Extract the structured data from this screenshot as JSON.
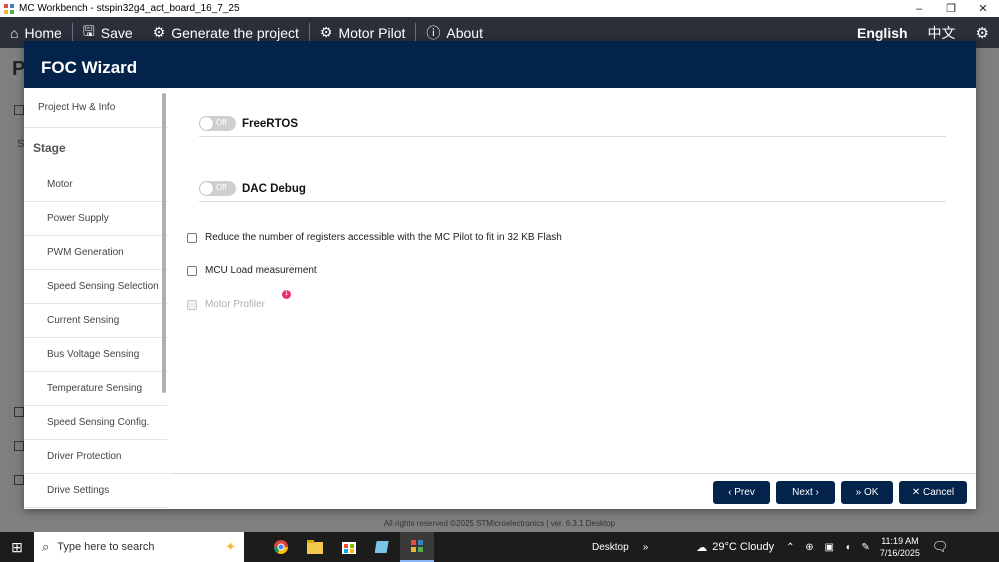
{
  "window": {
    "title": "MC Workbench - stspin32g4_act_board_16_7_25",
    "minimize": "–",
    "restore": "❐",
    "close": "✕"
  },
  "toolbar": {
    "home": "Home",
    "save": "Save",
    "generate": "Generate the project",
    "motor_pilot": "Motor Pilot",
    "about": "About",
    "lang_en": "English",
    "lang_zh": "中文"
  },
  "background": {
    "title": "P",
    "s_label": "S",
    "footer": "All rights reserved ©2025 STMicroelectronics | ver. 6.3.1 Desktop"
  },
  "wizard": {
    "title": "FOC Wizard",
    "sidebar": {
      "top_item": "Project Hw & Info",
      "stage_heading": "Stage",
      "items": [
        "Motor",
        "Power Supply",
        "PWM Generation",
        "Speed Sensing Selection",
        "Current Sensing",
        "Bus Voltage Sensing",
        "Temperature Sensing",
        "Speed Sensing Config.",
        "Driver Protection",
        "Drive Settings"
      ]
    },
    "toggles": [
      {
        "name": "FreeRTOS",
        "state": "Off"
      },
      {
        "name": "DAC Debug",
        "state": "Off"
      }
    ],
    "checks": [
      {
        "label": "Reduce the number of registers accessible with the MC Pilot to fit in 32 KB Flash",
        "checked": false,
        "disabled": false
      },
      {
        "label": "MCU Load measurement",
        "checked": false,
        "disabled": false
      },
      {
        "label": "Motor Profiler",
        "checked": false,
        "disabled": true,
        "badge": "1"
      }
    ],
    "buttons": {
      "prev": "Prev",
      "next": "Next",
      "ok": "OK",
      "cancel": "Cancel"
    }
  },
  "taskbar": {
    "search_placeholder": "Type here to search",
    "desktop": "Desktop",
    "weather": "29°C  Cloudy",
    "time": "11:19 AM",
    "date": "7/16/2025"
  },
  "colors": {
    "accent": "#03234b",
    "toolbar": "#2b2f3a",
    "badge": "#e8336b"
  }
}
